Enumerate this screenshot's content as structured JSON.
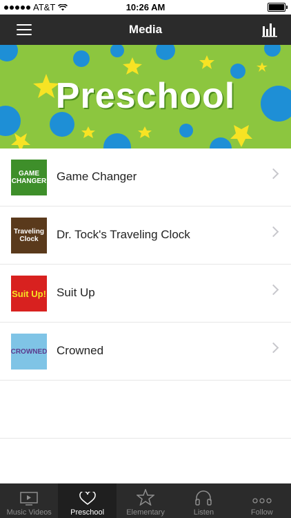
{
  "status_bar": {
    "carrier": "AT&T",
    "time": "10:26 AM"
  },
  "nav": {
    "title": "Media"
  },
  "banner": {
    "title": "Preschool",
    "colors": {
      "background": "#8cc63f",
      "circle": "#1e8fd6",
      "star": "#f7e324"
    }
  },
  "items": [
    {
      "label": "Game Changer",
      "thumb_text": "GAME CHANGER",
      "thumb_color": "#3e8f2a"
    },
    {
      "label": "Dr. Tock's Traveling Clock",
      "thumb_text": "Traveling Clock",
      "thumb_color": "#5a3a1c"
    },
    {
      "label": "Suit Up",
      "thumb_text": "Suit Up!",
      "thumb_color": "#d8211f"
    },
    {
      "label": "Crowned",
      "thumb_text": "CROWNED",
      "thumb_color": "#7fc4e6"
    }
  ],
  "tabs": [
    {
      "label": "Music Videos",
      "icon": "play-screen-icon",
      "active": false
    },
    {
      "label": "Preschool",
      "icon": "heart-icon",
      "active": true
    },
    {
      "label": "Elementary",
      "icon": "star-icon",
      "active": false
    },
    {
      "label": "Listen",
      "icon": "headphones-icon",
      "active": false
    },
    {
      "label": "Follow",
      "icon": "more-icon",
      "active": false
    }
  ]
}
